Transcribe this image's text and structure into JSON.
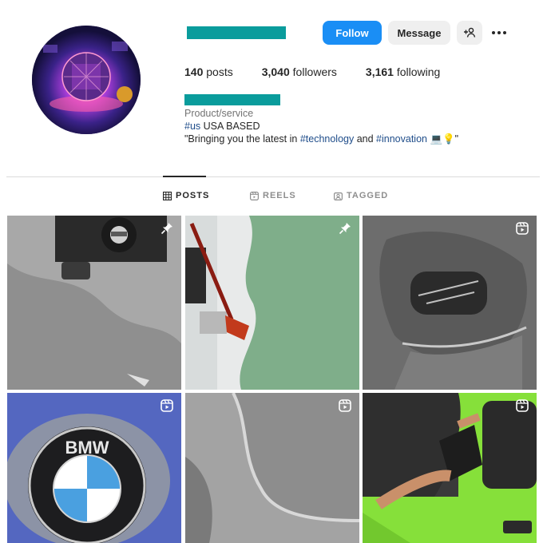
{
  "profile": {
    "avatar_icon": "tech-globe-avatar",
    "username_redacted": true,
    "name_redacted": true,
    "buttons": {
      "follow": "Follow",
      "message": "Message",
      "suggest_icon": "add-person-icon",
      "more_icon": "more-options-icon"
    },
    "stats": {
      "posts_count": "140",
      "posts_label": "posts",
      "followers_count": "3,040",
      "followers_label": "followers",
      "following_count": "3,161",
      "following_label": "following"
    },
    "bio": {
      "category": "Product/service",
      "line1_tag": "#us",
      "line1_text": " USA BASED",
      "line2_pre": "\"Bringing you the latest in ",
      "line2_tag1": "#technology",
      "line2_mid": " and ",
      "line2_tag2": "#innovation",
      "line2_post": " 💻💡\""
    }
  },
  "tabs": [
    {
      "label": "POSTS",
      "icon": "grid-icon",
      "active": true
    },
    {
      "label": "REELS",
      "icon": "reels-icon",
      "active": false
    },
    {
      "label": "TAGGED",
      "icon": "tagged-icon",
      "active": false
    }
  ],
  "grid": [
    {
      "subject": "car interior trim with key slot",
      "badge": "pin-icon"
    },
    {
      "subject": "shovel at salt lake shore",
      "badge": "pin-icon"
    },
    {
      "subject": "trim panel with cutout",
      "badge": "reel-icon"
    },
    {
      "subject": "BMW badge close-up",
      "badge": "reel-icon",
      "badge_text": "BMW"
    },
    {
      "subject": "grey panel edge close-up",
      "badge": "reel-icon"
    },
    {
      "subject": "green floor mat install",
      "badge": "reel-icon"
    }
  ],
  "colors": {
    "follow_button": "#1a8ef5",
    "secondary_button": "#efefef",
    "redaction_bar": "#0a9c9c",
    "hashtag": "#1f4d8a"
  }
}
